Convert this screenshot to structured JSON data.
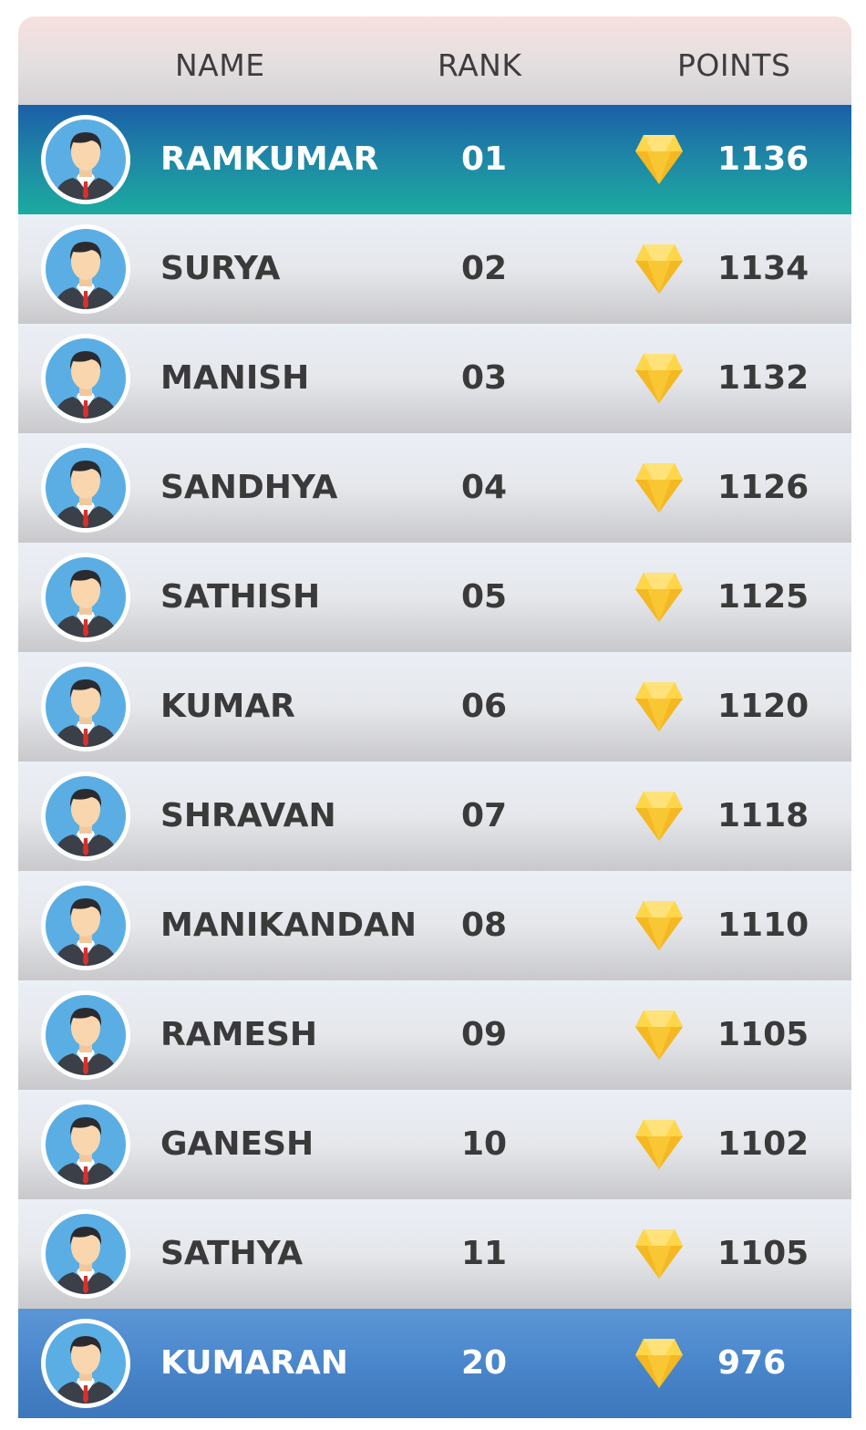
{
  "header": {
    "name": "NAME",
    "rank": "RANK",
    "points": "POINTS"
  },
  "colors": {
    "highlight_top": "#1e84a6",
    "highlight_bottom": "#4a86cb",
    "gem": "#f4b823"
  },
  "rows": [
    {
      "name": "RAMKUMAR",
      "rank": "01",
      "points": "1136"
    },
    {
      "name": "SURYA",
      "rank": "02",
      "points": "1134"
    },
    {
      "name": "MANISH",
      "rank": "03",
      "points": "1132"
    },
    {
      "name": "SANDHYA",
      "rank": "04",
      "points": "1126"
    },
    {
      "name": "SATHISH",
      "rank": "05",
      "points": "1125"
    },
    {
      "name": "KUMAR",
      "rank": "06",
      "points": "1120"
    },
    {
      "name": "SHRAVAN",
      "rank": "07",
      "points": "1118"
    },
    {
      "name": "MANIKANDAN",
      "rank": "08",
      "points": "1110"
    },
    {
      "name": "RAMESH",
      "rank": "09",
      "points": "1105"
    },
    {
      "name": "GANESH",
      "rank": "10",
      "points": "1102"
    },
    {
      "name": "SATHYA",
      "rank": "11",
      "points": "1105"
    },
    {
      "name": "KUMARAN",
      "rank": "20",
      "points": "976"
    }
  ]
}
